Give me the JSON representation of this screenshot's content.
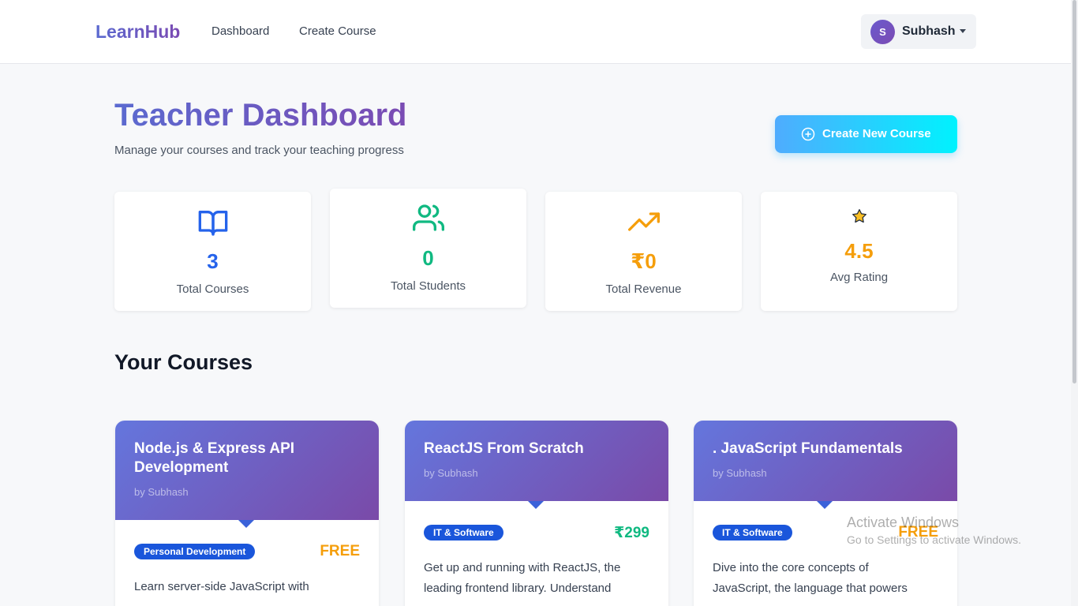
{
  "navbar": {
    "brand": "LearnHub",
    "links": [
      "Dashboard",
      "Create Course"
    ],
    "user": {
      "initial": "S",
      "name": "Subhash"
    }
  },
  "header": {
    "title": "Teacher Dashboard",
    "subtitle": "Manage your courses and track your teaching progress",
    "create_button": "Create New Course"
  },
  "stats": [
    {
      "value": "3",
      "label": "Total Courses",
      "icon": "book-open-icon",
      "color": "#2563eb"
    },
    {
      "value": "0",
      "label": "Total Students",
      "icon": "users-icon",
      "color": "#10b981"
    },
    {
      "value": "₹0",
      "label": "Total Revenue",
      "icon": "trending-up-icon",
      "color": "#f59e0b"
    },
    {
      "value": "4.5",
      "label": "Avg Rating",
      "icon": "star-icon",
      "color": "#f59e0b"
    }
  ],
  "section_title": "Your Courses",
  "courses": [
    {
      "title": "Node.js & Express API Development",
      "author": "by Subhash",
      "category": "Personal Development",
      "price": "FREE",
      "description_lines": [
        "Learn server-side JavaScript with"
      ]
    },
    {
      "title": "ReactJS From Scratch",
      "author": "by Subhash",
      "category": "IT & Software",
      "price": "₹299",
      "description_lines": [
        "Get up and running with ReactJS, the",
        "leading frontend library. Understand"
      ]
    },
    {
      "title": ". JavaScript Fundamentals",
      "author": "by Subhash",
      "category": "IT & Software",
      "price": "FREE",
      "description_lines": [
        "Dive into the core concepts of",
        "JavaScript, the language that powers"
      ]
    }
  ],
  "watermark": {
    "title": "Activate Windows",
    "subtitle": "Go to Settings to activate Windows."
  },
  "colors": {
    "brand_gradient_start": "#5b6ad0",
    "brand_gradient_end": "#7b4bb3",
    "free_price": "#f59e0b",
    "paid_price": "#10b981",
    "badge": "#1a56db"
  }
}
